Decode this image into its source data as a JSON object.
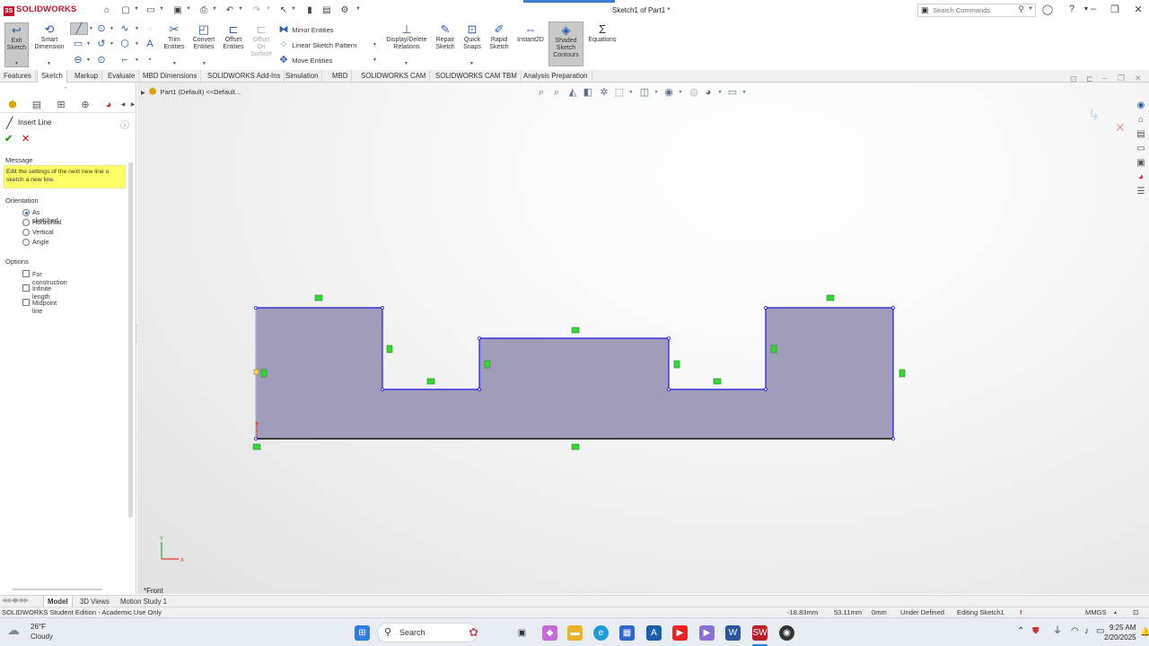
{
  "app": {
    "name": "SOLIDWORKS",
    "document_title": "Sketch1 of Part1 *"
  },
  "search": {
    "placeholder": "Search Commands"
  },
  "quick_access_icons": [
    "home-icon",
    "new-icon",
    "open-icon",
    "save-icon",
    "print-icon",
    "undo-icon",
    "redo-icon",
    "select-icon",
    "rebuild-icon",
    "file-properties-icon",
    "options-icon"
  ],
  "command_manager": {
    "exit_sketch": "Exit\nSketch",
    "smart_dimension": "Smart\nDimension",
    "trim_entities": "Trim\nEntities",
    "convert_entities": "Convert\nEntities",
    "offset_entities": "Offset\nEntities",
    "offset_on_surface": "Offset\nOn\nSurface",
    "mirror_entities": "Mirror Entities",
    "linear_sketch_pattern": "Linear Sketch Pattern",
    "move_entities": "Move Entities",
    "display_delete_relations": "Display/Delete\nRelations",
    "repair_sketch": "Repair\nSketch",
    "quick_snaps": "Quick\nSnaps",
    "rapid_sketch": "Rapid\nSketch",
    "instant2d": "Instant2D",
    "shaded_sketch_contours": "Shaded\nSketch\nContours",
    "equations": "Equations"
  },
  "tabs": [
    "Features",
    "Sketch",
    "Markup",
    "Evaluate",
    "MBD Dimensions",
    "SOLIDWORKS Add-Ins",
    "Simulation",
    "MBD",
    "SOLIDWORKS CAM",
    "SOLIDWORKS CAM TBM",
    "Analysis Preparation"
  ],
  "active_tab": "Sketch",
  "property_manager": {
    "title": "Insert Line",
    "message_header": "Message",
    "message": "Edit the settings of the next new line o sketch a new line.",
    "orientation_header": "Orientation",
    "orientation_options": [
      "As sketched",
      "Horizontal",
      "Vertical",
      "Angle"
    ],
    "orientation_selected": "As sketched",
    "options_header": "Options",
    "options": [
      "For construction",
      "Infinite length",
      "Midpoint line"
    ]
  },
  "feature_tree": {
    "root": "Part1 (Default) <<Default..."
  },
  "view_label": "*Front",
  "bottom_tabs": [
    "Model",
    "3D Views",
    "Motion Study 1"
  ],
  "bottom_active": "Model",
  "status": {
    "edition": "SOLIDWORKS Student Edition - Academic Use Only",
    "x": "-18.83mm",
    "y": "53.11mm",
    "z": "0mm",
    "state": "Under Defined",
    "editing": "Editing Sketch1",
    "units": "MMGS"
  },
  "taskbar": {
    "weather_temp": "26°F",
    "weather_desc": "Cloudy",
    "search_label": "Search",
    "time": "9:25 AM",
    "date": "2/20/2025"
  },
  "colors": {
    "sketch_fill": "#a09cba",
    "sketch_line": "#1a1ae0",
    "relation": "#39d439",
    "accent": "#2364c4"
  }
}
